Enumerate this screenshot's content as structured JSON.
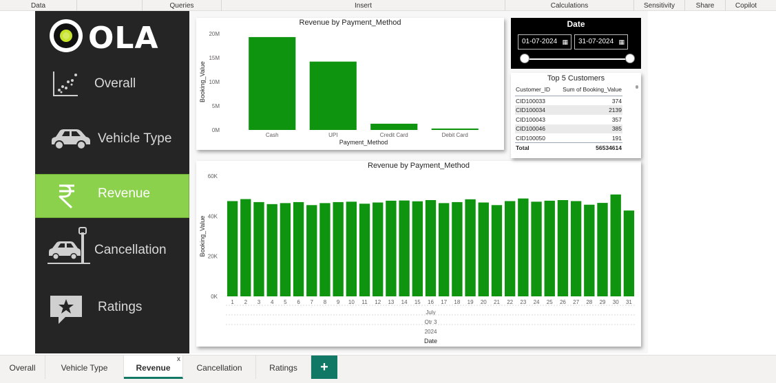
{
  "ribbon": [
    "Data",
    "Queries",
    "Insert",
    "Calculations",
    "Sensitivity",
    "Share",
    "Copilot"
  ],
  "logo_text": "OLA",
  "nav": [
    {
      "label": "Overall",
      "icon": "scatter-chart-icon"
    },
    {
      "label": "Vehicle Type",
      "icon": "car-icon"
    },
    {
      "label": "Revenue",
      "icon": "rupee-icon",
      "active": true
    },
    {
      "label": "Cancellation",
      "icon": "car-crash-icon"
    },
    {
      "label": "Ratings",
      "icon": "star-chat-icon"
    }
  ],
  "colors": {
    "bar": "#0f9410",
    "accent": "#8bd14b",
    "sidebar": "#252525",
    "tab_active": "#117865"
  },
  "date_slicer": {
    "title": "Date",
    "start": "01-07-2024",
    "end": "31-07-2024"
  },
  "top_customers": {
    "title": "Top 5 Customers",
    "columns": [
      "Customer_ID",
      "Sum of Booking_Value"
    ],
    "rows": [
      [
        "CID100033",
        "374"
      ],
      [
        "CID100034",
        "2139"
      ],
      [
        "CID100043",
        "357"
      ],
      [
        "CID100046",
        "385"
      ],
      [
        "CID100050",
        "191"
      ]
    ],
    "total_label": "Total",
    "total_value": "56534614"
  },
  "chart_data": [
    {
      "type": "bar",
      "title": "Revenue by Payment_Method",
      "xlabel": "Payment_Method",
      "ylabel": "Booking_Value",
      "categories": [
        "Cash",
        "UPI",
        "Credit Card",
        "Debit Card"
      ],
      "values": [
        19300000,
        14200000,
        1300000,
        300000
      ],
      "ylim": [
        0,
        20000000
      ],
      "yticks": [
        "0M",
        "5M",
        "10M",
        "15M",
        "20M"
      ],
      "grid": false
    },
    {
      "type": "bar",
      "title": "Revenue by Payment_Method",
      "xlabel": "Date",
      "ylabel": "Booking_Value",
      "categories": [
        "1",
        "2",
        "3",
        "4",
        "5",
        "6",
        "7",
        "8",
        "9",
        "10",
        "11",
        "12",
        "13",
        "14",
        "15",
        "16",
        "17",
        "18",
        "19",
        "20",
        "21",
        "22",
        "23",
        "24",
        "25",
        "26",
        "27",
        "28",
        "29",
        "30",
        "31"
      ],
      "values": [
        47500,
        48500,
        47000,
        46000,
        46500,
        47000,
        45500,
        46500,
        47000,
        47200,
        46200,
        46800,
        47700,
        47800,
        47400,
        48000,
        46500,
        47000,
        48400,
        46800,
        45500,
        47500,
        48800,
        47200,
        47700,
        48000,
        47500,
        45700,
        46600,
        50800,
        42800
      ],
      "ylim": [
        0,
        60000
      ],
      "yticks": [
        "0K",
        "20K",
        "40K",
        "60K"
      ],
      "hierarchy": {
        "month": "July",
        "quarter": "Qtr 3",
        "year": "2024"
      },
      "grid": false
    }
  ],
  "tabs": [
    "Overall",
    "Vehicle Type",
    "Revenue",
    "Cancellation",
    "Ratings"
  ],
  "active_tab": "Revenue",
  "add_tab_label": "+",
  "close_label": "x"
}
